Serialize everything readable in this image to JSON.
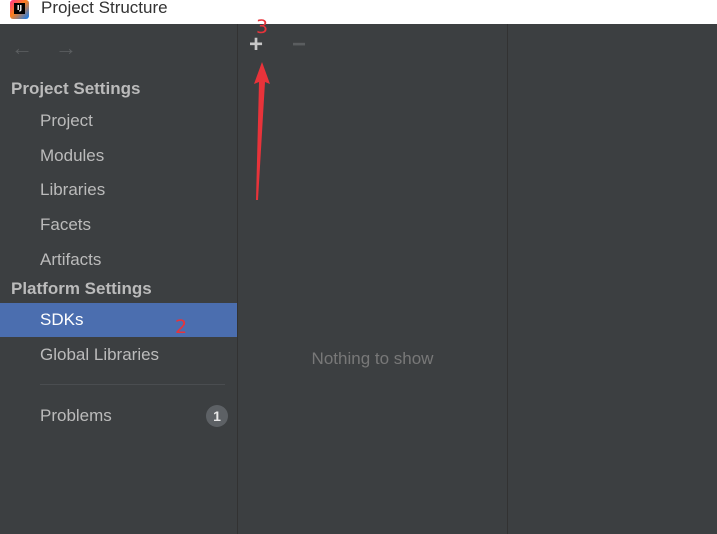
{
  "window": {
    "title": "Project Structure"
  },
  "nav": {
    "back_icon": "←",
    "forward_icon": "→"
  },
  "sidebar": {
    "project_settings_heading": "Project Settings",
    "project_items": [
      {
        "label": "Project"
      },
      {
        "label": "Modules"
      },
      {
        "label": "Libraries"
      },
      {
        "label": "Facets"
      },
      {
        "label": "Artifacts"
      }
    ],
    "platform_settings_heading": "Platform Settings",
    "platform_items": [
      {
        "label": "SDKs",
        "selected": true
      },
      {
        "label": "Global Libraries"
      }
    ],
    "problems": {
      "label": "Problems",
      "count": "1"
    }
  },
  "middle": {
    "add_icon": "+",
    "remove_icon": "−",
    "empty_text": "Nothing to show"
  },
  "annotations": {
    "step_2": "2",
    "step_3": "3"
  },
  "colors": {
    "selection": "#4b6eaf",
    "annotation": "#e8333a",
    "background": "#3c3f41"
  }
}
